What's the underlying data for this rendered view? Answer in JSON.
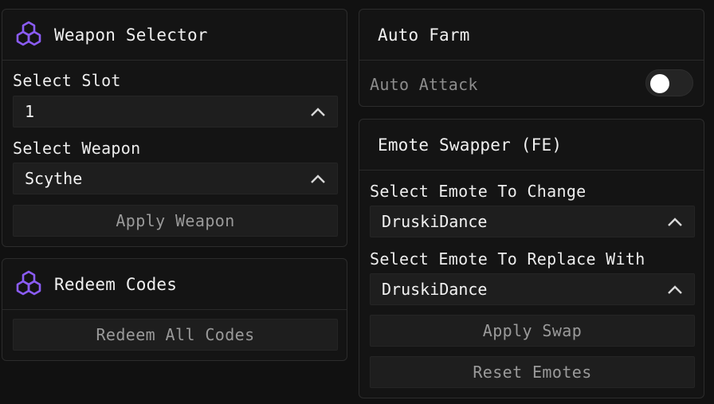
{
  "weapon_selector": {
    "title": "Weapon Selector",
    "icon": "cubes-icon",
    "slot_label": "Select Slot",
    "slot_value": "1",
    "weapon_label": "Select Weapon",
    "weapon_value": "Scythe",
    "apply_label": "Apply Weapon"
  },
  "redeem_codes": {
    "title": "Redeem Codes",
    "icon": "cubes-icon",
    "redeem_label": "Redeem All Codes"
  },
  "auto_farm": {
    "title": "Auto Farm",
    "auto_attack_label": "Auto Attack",
    "auto_attack_enabled": false
  },
  "emote_swapper": {
    "title": "Emote Swapper (FE)",
    "change_label": "Select Emote To Change",
    "change_value": "DruskiDance",
    "replace_label": "Select Emote To Replace With",
    "replace_value": "DruskiDance",
    "apply_label": "Apply Swap",
    "reset_label": "Reset Emotes"
  },
  "colors": {
    "background": "#111111",
    "panel": "#141414",
    "control": "#1e1e1e",
    "accent_icon": "#8b5cf6",
    "muted_text": "#9a9a9a"
  }
}
